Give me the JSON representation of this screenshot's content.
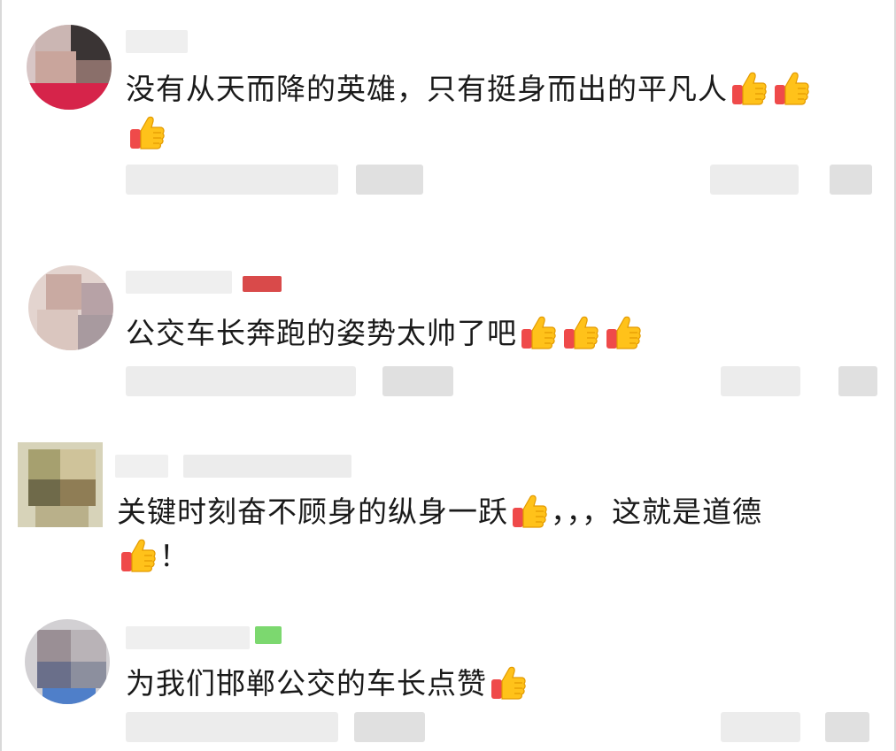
{
  "comments": [
    {
      "text": "没有从天而降的英雄，只有挺身而出的平凡人",
      "thumbs_inline": 2,
      "second_line": "",
      "thumbs_second_line": 1
    },
    {
      "text": "公交车长奔跑的姿势太帅了吧",
      "thumbs_inline": 3,
      "second_line": "",
      "thumbs_second_line": 0
    },
    {
      "text": "关键时刻奋不顾身的纵身一跃",
      "after_thumb": "，，，这就是道德",
      "thumbs_inline": 1,
      "second_line": "！",
      "thumbs_second_line": 1
    },
    {
      "text": "为我们邯郸公交的车长点赞",
      "thumbs_inline": 1,
      "second_line": "",
      "thumbs_second_line": 0
    }
  ],
  "icons": {
    "thumb": "thumbs-up-icon",
    "comment": "comment-icon",
    "like": "heart-icon"
  },
  "colors": {
    "thumb_fill": "#ffc21a",
    "thumb_cuff": "#ef4a4a",
    "text": "#1a1a1a"
  }
}
